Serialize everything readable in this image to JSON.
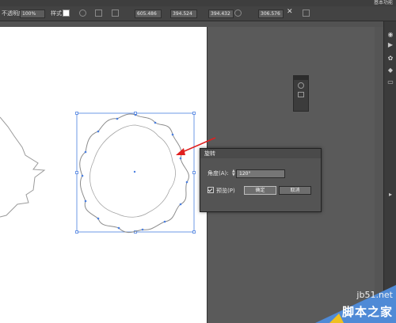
{
  "toolbar": {
    "top_right": "基本功能",
    "opacity_label": "不透明度",
    "opacity_value": "100%",
    "style_label": "样式",
    "x_value": "605.486",
    "y_value": "394.524",
    "w_value": "394.432",
    "h_value": "306.576"
  },
  "dialog": {
    "title": "旋转",
    "angle_label": "角度(A):",
    "angle_value": "120°",
    "preview_label": "预览(P)",
    "ok_label": "确定",
    "cancel_label": "取消"
  },
  "watermark": {
    "domain": "jb51.net",
    "name": "脚本之家"
  },
  "colors": {
    "selection": "#4a7fe0",
    "arrow": "#e02020",
    "dialog_bg": "#545454"
  }
}
